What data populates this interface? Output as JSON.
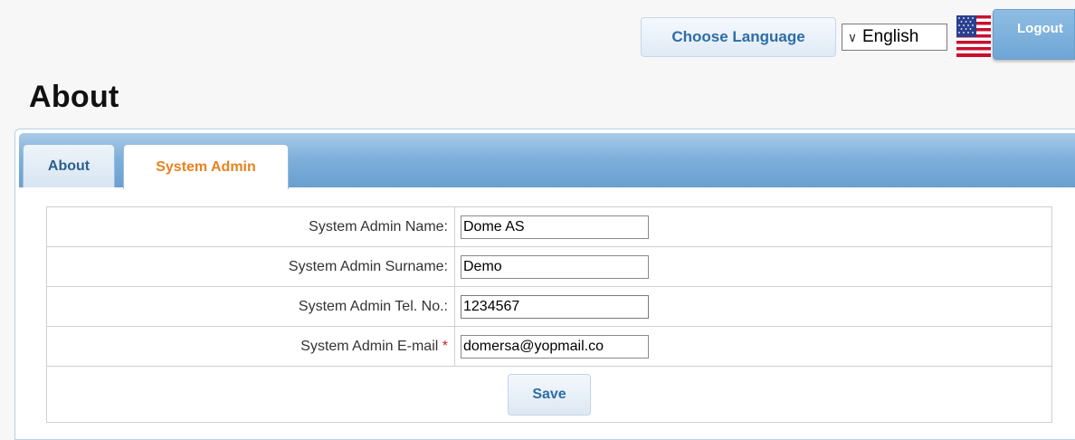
{
  "header": {
    "choose_language_label": "Choose Language",
    "language_selected": "English",
    "logout_label": "Logout"
  },
  "page": {
    "title": "About"
  },
  "tabs": [
    {
      "label": "About",
      "active": false
    },
    {
      "label": "System Admin",
      "active": true
    }
  ],
  "form": {
    "fields": [
      {
        "label": "System Admin Name:",
        "value": "Dome AS",
        "required": false
      },
      {
        "label": "System Admin Surname:",
        "value": "Demo",
        "required": false
      },
      {
        "label": "System Admin Tel. No.:",
        "value": "1234567",
        "required": false
      },
      {
        "label": "System Admin E-mail",
        "value": "domersa@yopmail.co",
        "required": true,
        "required_mark": "*"
      }
    ],
    "save_label": "Save"
  },
  "colors": {
    "accent_blue": "#2e6da4",
    "active_tab_text": "#e8821f",
    "required_star": "#d21e1e",
    "tab_strip": "#7fb0dc"
  },
  "icons": {
    "language_dropdown": "chevron-down-icon",
    "flag": "us-flag-icon"
  }
}
